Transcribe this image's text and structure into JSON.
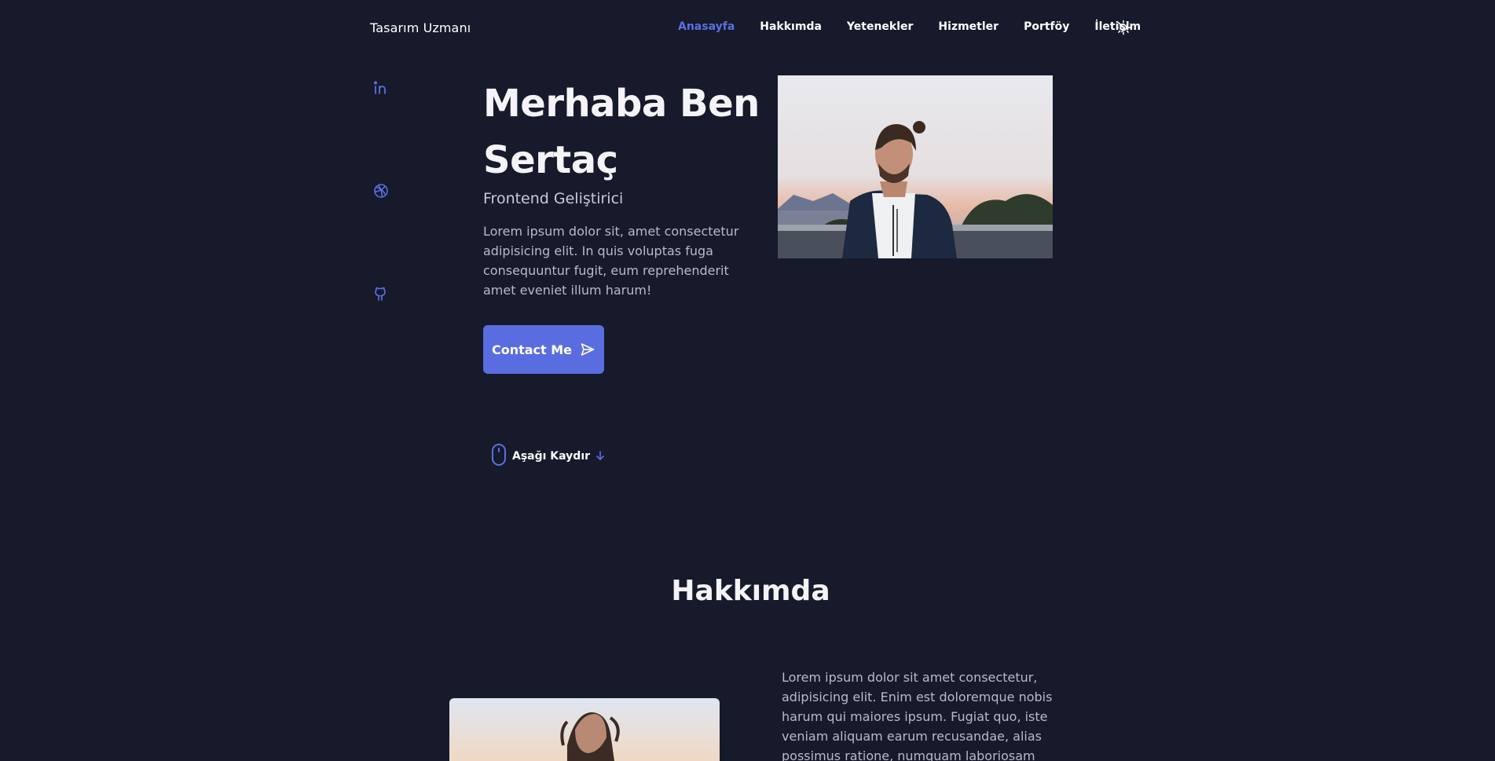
{
  "header": {
    "brand": "Tasarım Uzmanı",
    "nav": [
      {
        "label": "Anasayfa",
        "active": true
      },
      {
        "label": "Hakkımda",
        "active": false
      },
      {
        "label": "Yetenekler",
        "active": false
      },
      {
        "label": "Hizmetler",
        "active": false
      },
      {
        "label": "Portföy",
        "active": false
      },
      {
        "label": "İletişim",
        "active": false
      }
    ],
    "theme_icon": "sun-icon"
  },
  "social": [
    {
      "icon": "linkedin-icon"
    },
    {
      "icon": "dribbble-icon"
    },
    {
      "icon": "github-icon"
    }
  ],
  "hero": {
    "title_line1": "Merhaba Ben",
    "title_line2": "Sertaç",
    "subtitle": "Frontend Geliştirici",
    "description": "Lorem ipsum dolor sit, amet consectetur adipisicing elit. In quis voluptas fuga consequuntur fugit, eum reprehenderit amet eveniet illum harum!",
    "contact_label": "Contact Me",
    "contact_icon": "send-icon",
    "scroll_label": "Aşağı Kaydır",
    "scroll_icon": "mouse-icon",
    "scroll_arrow_icon": "arrow-down-icon"
  },
  "about": {
    "title": "Hakkımda",
    "text": "Lorem ipsum dolor sit amet consectetur, adipisicing elit. Enim est doloremque nobis harum qui maiores ipsum. Fugiat quo, iste veniam aliquam earum recusandae, alias possimus ratione, numquam laboriosam"
  },
  "colors": {
    "background": "#161a2a",
    "accent": "#5b6fe3",
    "text": "#ffffff",
    "muted": "#b8bac7"
  }
}
